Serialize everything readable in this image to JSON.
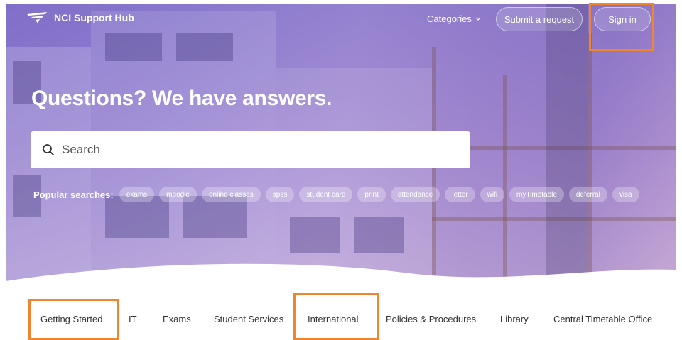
{
  "header": {
    "brand": "NCI Support Hub",
    "categories_label": "Categories",
    "submit_request_label": "Submit a request",
    "sign_in_label": "Sign in"
  },
  "hero": {
    "headline": "Questions? We have answers.",
    "search_placeholder": "Search",
    "popular_label": "Popular searches:",
    "popular_tags": [
      "exams",
      "moodle",
      "online classes",
      "spss",
      "student card",
      "print",
      "attendance",
      "letter",
      "wifi",
      "myTimetable",
      "deferral",
      "visa"
    ]
  },
  "category_nav": {
    "items": [
      "Getting Started",
      "IT",
      "Exams",
      "Student Services",
      "International",
      "Policies & Procedures",
      "Library",
      "Central Timetable Office"
    ]
  },
  "colors": {
    "highlight": "#f0852d",
    "hero_tint": "#8a7bc9"
  },
  "icons": [
    "nci-logo-icon",
    "chevron-down-icon",
    "search-icon"
  ]
}
